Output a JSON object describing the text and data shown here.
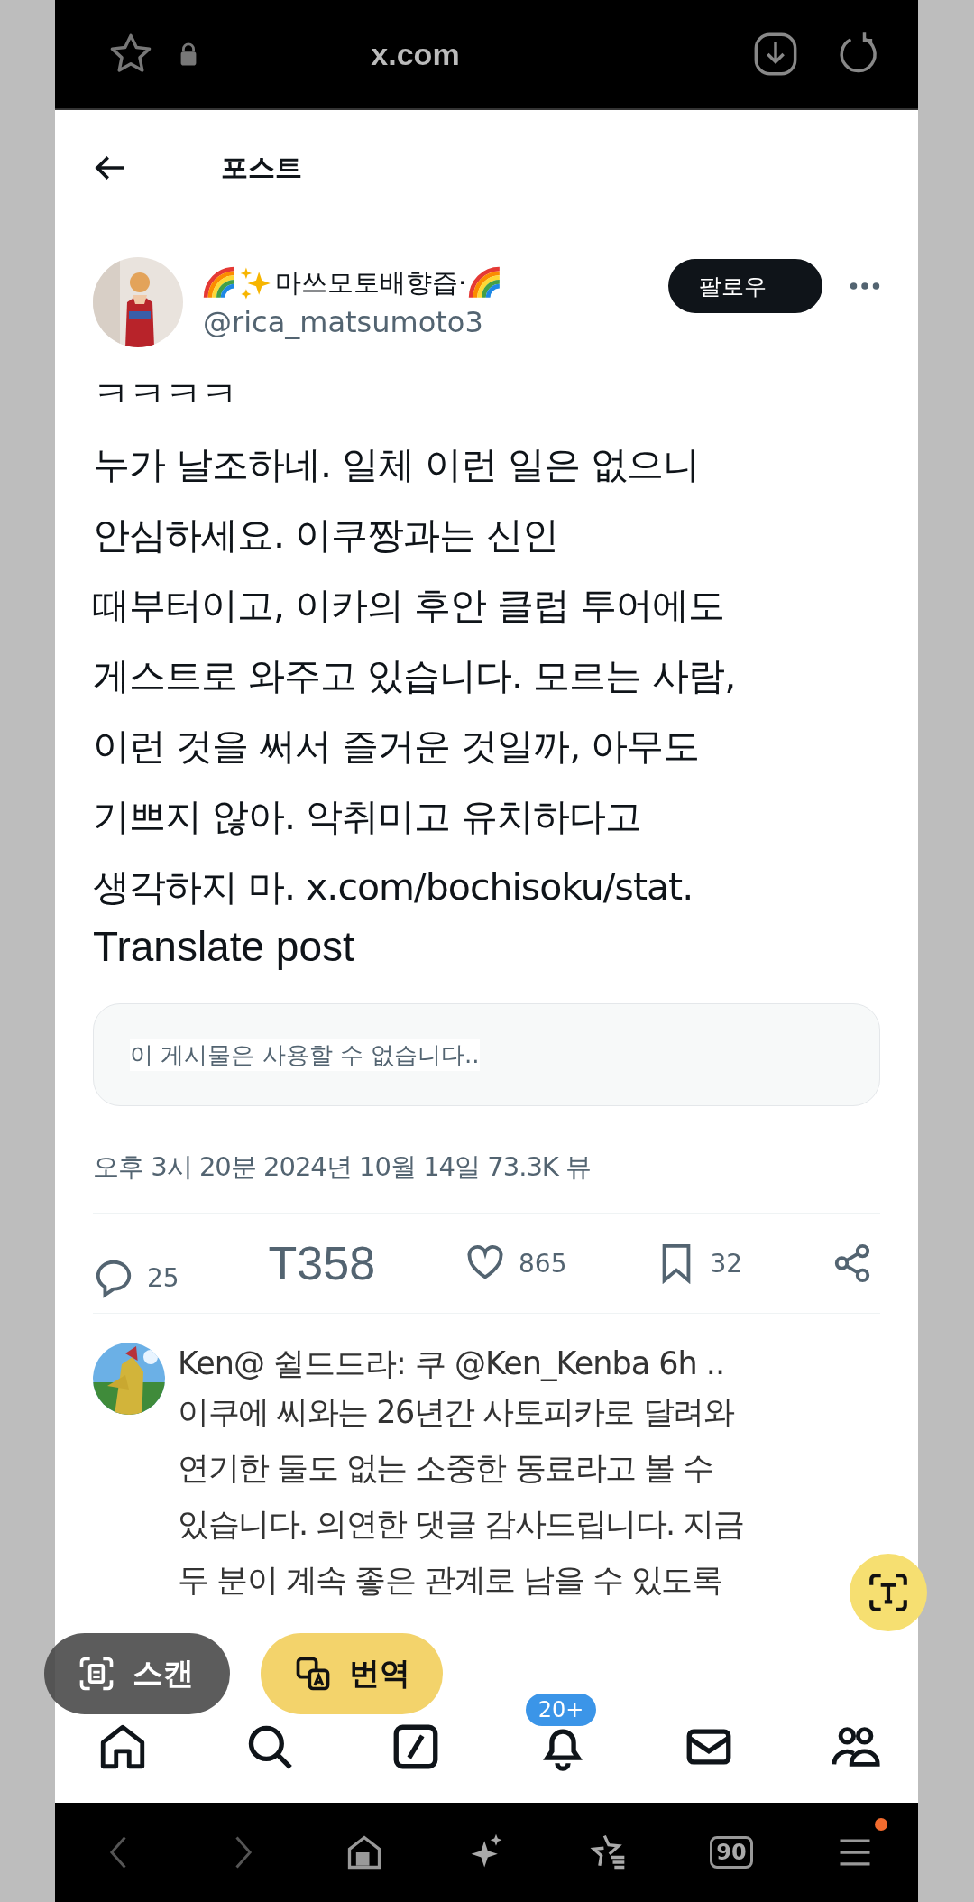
{
  "browser": {
    "url": "x.com"
  },
  "header": {
    "title": "포스트"
  },
  "post": {
    "author": {
      "name": "마쓰모토배향즙·",
      "handle": "@rica_matsumoto3"
    },
    "follow_label": "팔로우",
    "text": "ㅋㅋㅋㅋ\n누가 날조하네. 일체 이런 일은 없으니\n안심하세요. 이쿠짱과는 신인\n때부터이고, 이카의 후안 클럽 투어에도\n게스트로 와주고 있습니다. 모르는 사람,\n이런 것을 써서 즐거운 것일까, 아무도\n기쁘지 않아. 악취미고 유치하다고\n생각하지 마. x.com/bochisoku/stat.",
    "translate": "Translate post",
    "quote": "이 게시물은 사용할 수 없습니다..",
    "meta": "오후 3시 20분 2024년 10월 14일 73.3K 뷰",
    "stats": [
      {
        "kind": "reply",
        "count": "25"
      },
      {
        "kind": "repost",
        "count": "T358"
      },
      {
        "kind": "like",
        "count": "865"
      },
      {
        "kind": "bookmark",
        "count": "32"
      },
      {
        "kind": "share"
      }
    ]
  },
  "reply": {
    "header": "Ken@ 쉴드드라: 쿠 @Ken_Kenba 6h ..",
    "text": "이쿠에 씨와는 26년간 사토피카로 달려와\n연기한 둘도 없는 소중한 동료라고 볼 수\n있습니다. 의연한 댓글 감사드립니다. 지금\n두 분이 계속 좋은 관계로 남을 수 있도록"
  },
  "overlay": {
    "scan": "스캔",
    "translate": "번역"
  },
  "nav": [
    {
      "kind": "home"
    },
    {
      "kind": "search"
    },
    {
      "kind": "compose"
    },
    {
      "kind": "bell",
      "badge": "20+"
    },
    {
      "kind": "mail"
    },
    {
      "kind": "people"
    }
  ],
  "browser_bar": {
    "tabs_count": "90"
  }
}
